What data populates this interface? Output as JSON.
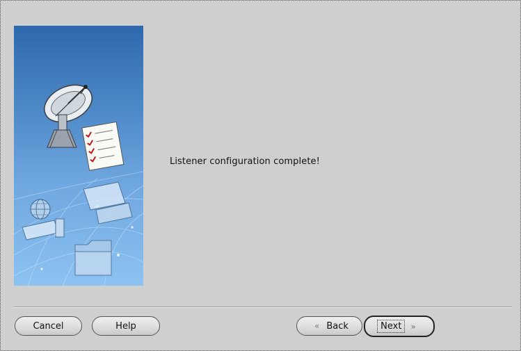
{
  "content": {
    "message": "Listener configuration complete!"
  },
  "buttons": {
    "cancel": "Cancel",
    "help": "Help",
    "back": "Back",
    "next": "Next",
    "back_chevron": "«",
    "next_chevron": "»"
  },
  "colors": {
    "panel_top": "#2f69ad",
    "panel_bottom": "#8cc3f1",
    "window_bg": "#cfcfcf"
  }
}
